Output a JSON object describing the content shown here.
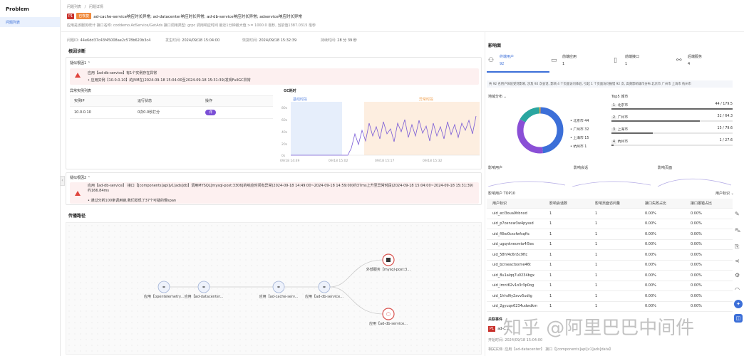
{
  "sidebar": {
    "title": "Problem",
    "item": "问题列表"
  },
  "breadcrumb": {
    "parent": "问题列表",
    "current": "问题详情"
  },
  "problem": {
    "badge_p": "P1",
    "badge_status": "已恢复",
    "title": "ad-cache-service响应时长异常; ad-datacenter响应时长异常; ad-db-service响应时长异常; adservice响应时长异常",
    "desc": "应用是该服务统计 接口名称: coddemo.AdService/GetAds 接口调用类型: grpc 调用响应时间 最近1分钟最大值 >= 1000.0 毫秒, 当前值1387.0315 毫秒",
    "meta": [
      {
        "k": "问题ID",
        "v": "44e6dd37c43f45008ae2c578b620b3c4"
      },
      {
        "k": "发生时间",
        "v": "2024/09/18 15:04:00"
      },
      {
        "k": "恢复时间",
        "v": "2024/09/18 15:32:39"
      },
      {
        "k": "持续时间",
        "v": "28 分 39 秒"
      }
    ]
  },
  "rca": {
    "section": "根因诊断",
    "r1": {
      "label": "疑似根因1",
      "line1": "应用【ad-db-service】有1个实例存在异常",
      "line2": "应用实例【10.0.0.10】的JVM在(2024-09-18 15:04:00至2024-09-18 15:31:39)发现FullGC异常",
      "table_title": "异常实例列表",
      "headers": [
        "实例IP",
        "运行状态",
        "操作"
      ],
      "row": {
        "ip": "10.0.0.10",
        "status": "0次0.0秒打分",
        "op": "详"
      },
      "chart": {
        "title": "GC耗时",
        "legend_normal": "基线时段",
        "legend_abnormal": "异常时段",
        "yticks": [
          "80s",
          "60s",
          "40s",
          "20s",
          "0s"
        ],
        "xticks": [
          "09/18 14:49",
          "09/18 15:02",
          "09/18 15:17",
          "09/18 15:32"
        ]
      }
    },
    "r2": {
      "label": "疑似根因2",
      "line1": "应用【ad-db-service】 接口【[components]api]v1]ads]db】调用MYSQL[mysql-post:3306]的响应时间有异常(2024-09-18 14:49:00~2024-09-18 14:59:00)约37ms上升至异常时段(2024-09-18 15:04:00~2024-09-18 15:31:39)约166.84ms",
      "line2": "通过分析100条调用链,我们发现了37个可疑的慢span"
    }
  },
  "topology": {
    "section": "传播路径",
    "nodes": [
      {
        "label": "应用【opentelemetry..."
      },
      {
        "label": "应用【ad-datacenter..."
      },
      {
        "label": "应用【ad-cache-serv..."
      },
      {
        "label": "应用【ad-db-service..."
      },
      {
        "label": "外部服务【mysql-post:3..."
      },
      {
        "label": "应用【ad-db-service..."
      }
    ]
  },
  "impact": {
    "section": "影响面",
    "cards": [
      {
        "label": "终端用户",
        "value": "92"
      },
      {
        "label": "前端应用",
        "value": "1"
      },
      {
        "label": "前端接口",
        "value": "1"
      },
      {
        "label": "后端服务",
        "value": "4"
      }
    ],
    "summary": "共 92 名用户体验受到影响, 涉及 92 次会话, 影响 4 个页面访问体验, 引起 1 个页面访问报错 92 次, 高频影响城市分布 北京市 广州市 上海市 杭州市",
    "region_label": "地域分布",
    "donut_legend": [
      {
        "name": "北京市",
        "val": "44",
        "color": "#3c6fd8"
      },
      {
        "name": "广州市",
        "val": "32",
        "color": "#8a4fd6"
      },
      {
        "name": "上海市",
        "val": "15",
        "color": "#2aa6a0"
      },
      {
        "name": "杭州市",
        "val": "1",
        "color": "#f0a43c"
      }
    ],
    "top5_title": "Top5 城市",
    "top5": [
      {
        "rank": "1",
        "city": "北京市",
        "val": "44 / 179.5"
      },
      {
        "rank": "2",
        "city": "广州市",
        "val": "32 / 64.3"
      },
      {
        "rank": "3",
        "city": "上海市",
        "val": "15 / 79.6"
      },
      {
        "rank": "4",
        "city": "杭州市",
        "val": "1 / 27.6"
      }
    ],
    "mini_charts": [
      "影响用户",
      "影响会话",
      "影响页面"
    ],
    "users_title": "影响用户 TOP10",
    "users_filter": "用户标识",
    "users_headers": [
      "用户标识",
      "影响会话数",
      "影响页面访问量",
      "接口失败占比",
      "接口报错占比"
    ],
    "users": [
      {
        "id": "uid_ecl3oua9hbnxd",
        "a": "1",
        "b": "1",
        "c": "0.00%",
        "d": "0.00%"
      },
      {
        "id": "uid_p7oxnxw3w4pyssd",
        "a": "1",
        "b": "1",
        "c": "0.00%",
        "d": "0.00%"
      },
      {
        "id": "uid_f0ko0cxcfwfsqftc",
        "a": "1",
        "b": "1",
        "c": "0.00%",
        "d": "0.00%"
      },
      {
        "id": "uid_ugqnkvecmto4i5es",
        "a": "1",
        "b": "1",
        "c": "0.00%",
        "d": "0.00%"
      },
      {
        "id": "uid_58hf4c6n5c9ftc",
        "a": "1",
        "b": "1",
        "c": "0.00%",
        "d": "0.00%"
      },
      {
        "id": "uid_bcrseactxxme46t",
        "a": "1",
        "b": "1",
        "c": "0.00%",
        "d": "0.00%"
      },
      {
        "id": "uid_8u1alqq7u0234bgx",
        "a": "1",
        "b": "1",
        "c": "0.00%",
        "d": "0.00%"
      },
      {
        "id": "uid_imnt62v1o3r3p0og",
        "a": "1",
        "b": "1",
        "c": "0.00%",
        "d": "0.00%"
      },
      {
        "id": "uid_1hhdfiy2avv5udtg",
        "a": "1",
        "b": "1",
        "c": "0.00%",
        "d": "0.00%"
      },
      {
        "id": "uid_2gyuqn6234udwdkm",
        "a": "1",
        "b": "1",
        "c": "0.00%",
        "d": "0.00%"
      }
    ],
    "related_title": "关联事件",
    "related_badge": "P1",
    "related_name": "ad-c...",
    "related_time": "开始时间: 2024/09/18 15:04:00",
    "related_obj": "相关实体: 应用【ad-datacenter】 接口【[components]api]v1]ads]data】"
  },
  "watermark": "知乎 @阿里巴巴中间件"
}
